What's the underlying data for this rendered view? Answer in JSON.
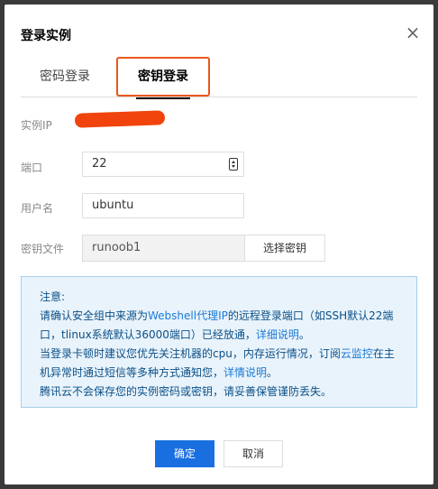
{
  "dialog": {
    "title": "登录实例",
    "close_icon": "close-icon"
  },
  "tabs": [
    {
      "label": "密码登录",
      "active": false
    },
    {
      "label": "密钥登录",
      "active": true
    }
  ],
  "form": {
    "ip_label": "实例IP",
    "port_label": "端口",
    "port_value": "22",
    "user_label": "用户名",
    "user_value": "ubuntu",
    "key_label": "密钥文件",
    "key_value": "runoob1",
    "select_key_label": "选择密钥"
  },
  "notice": {
    "heading": "注意:",
    "line1_a": "请确认安全组中来源为",
    "line1_link": "Webshell代理IP",
    "line1_b": "的远程登录端口（如SSH默认22端口，tlinux系统默认36000端口）已经放通，",
    "line1_link2": "详细说明",
    "line1_c": "。",
    "line2_a": "当登录卡顿时建议您优先关注机器的cpu，内存运行情况，订阅",
    "line2_link": "云监控",
    "line2_b": "在主机异常时通过短信等多种方式通知您，",
    "line2_link2": "详情说明",
    "line2_c": "。",
    "line3": "腾讯云不会保存您的实例密码或密钥，请妥善保管谨防丢失。"
  },
  "footer": {
    "ok_label": "确定",
    "cancel_label": "取消"
  },
  "colors": {
    "primary": "#1a6fe0",
    "highlight": "#e8571b",
    "notice_bg": "#e9f3fb"
  }
}
